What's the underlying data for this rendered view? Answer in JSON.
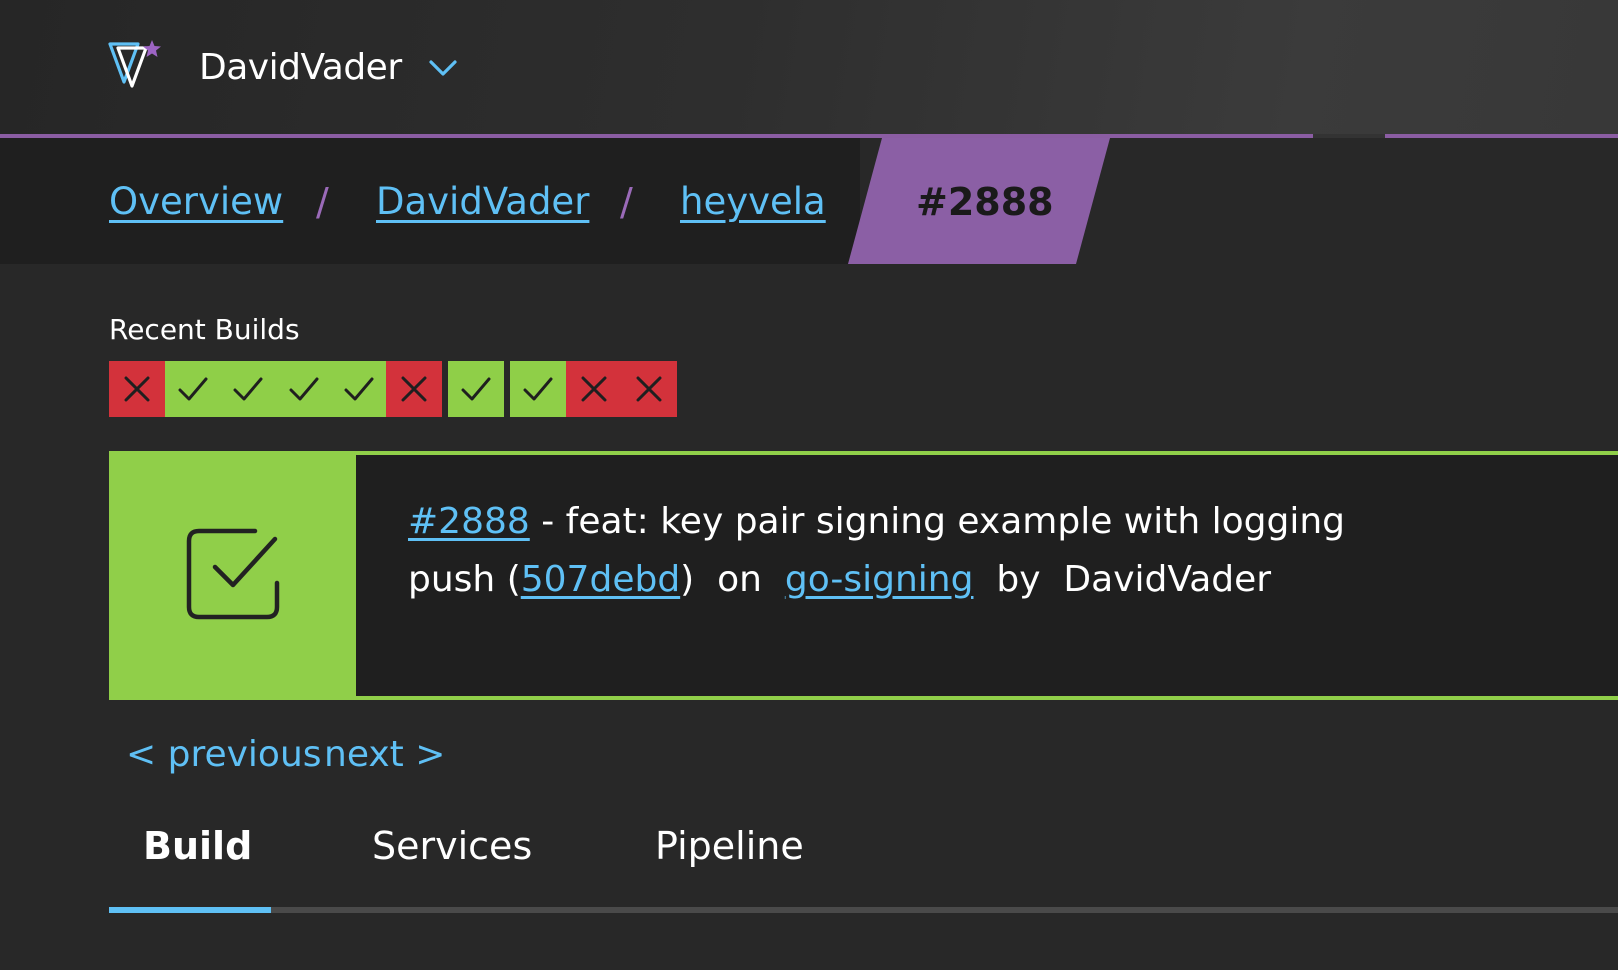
{
  "header": {
    "org_name": "DavidVader",
    "logo_icon": "vela-logo-icon",
    "dropdown_icon": "chevron-down-icon"
  },
  "breadcrumb": {
    "items": [
      {
        "label": "Overview"
      },
      {
        "label": "DavidVader"
      },
      {
        "label": "heyvela"
      }
    ],
    "separator": "/",
    "current": "#2888"
  },
  "recent_builds": {
    "label": "Recent Builds",
    "statuses": [
      "failure",
      "success",
      "success",
      "success",
      "success",
      "failure",
      "success",
      "success",
      "failure",
      "failure"
    ]
  },
  "build": {
    "status": "success",
    "status_icon": "checkbox-check-icon",
    "number": "#2888",
    "message": "- feat: key pair signing example with logging",
    "event": "push",
    "commit": "507debd",
    "on_text": "on",
    "branch": "go-signing",
    "by_text": "by",
    "author": "DavidVader"
  },
  "pagination": {
    "previous": "< previous",
    "next": "next >"
  },
  "tabs": [
    {
      "label": "Build",
      "active": true
    },
    {
      "label": "Services",
      "active": false
    },
    {
      "label": "Pipeline",
      "active": false
    }
  ],
  "colors": {
    "accent": "#8b5fa5",
    "link": "#5fc0f5",
    "success": "#90cf49",
    "failure": "#d3323b",
    "background": "#282828"
  }
}
